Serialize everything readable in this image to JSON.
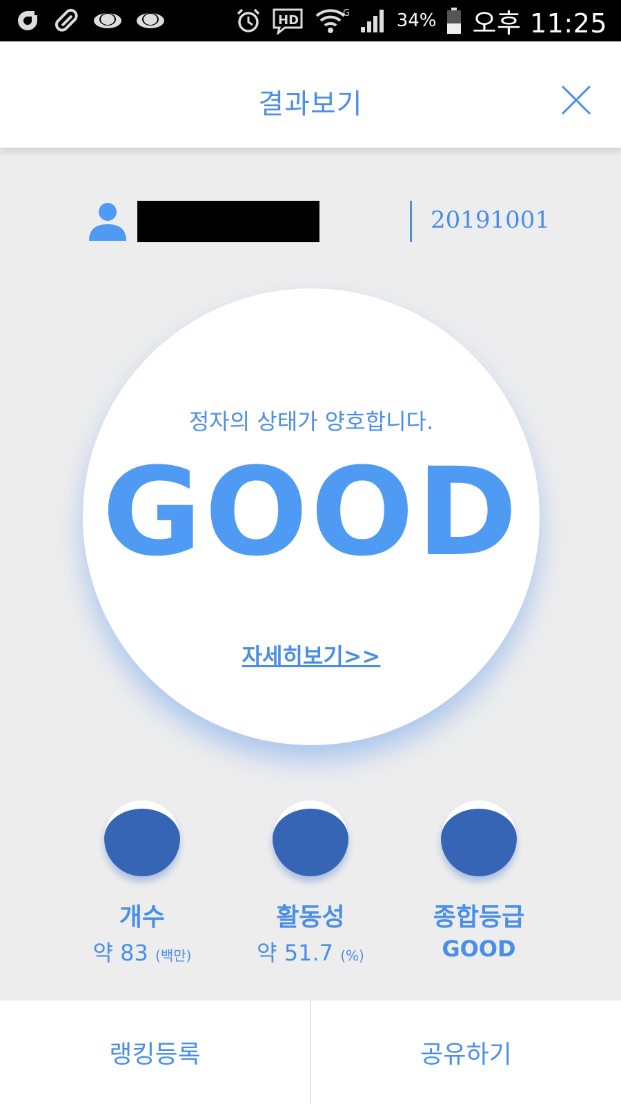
{
  "status_bar": {
    "battery": "34%",
    "time": "오후 11:25"
  },
  "header": {
    "title": "결과보기"
  },
  "user": {
    "date": "20191001"
  },
  "result": {
    "message": "정자의 상태가 양호합니다.",
    "grade": "GOOD",
    "detail_link": "자세히보기>>"
  },
  "stats": [
    {
      "label": "개수",
      "prefix": "약 ",
      "value": "83",
      "unit": "(백만)"
    },
    {
      "label": "활동성",
      "prefix": "약 ",
      "value": "51.7",
      "unit": "(%)"
    },
    {
      "label": "종합등급",
      "value": "GOOD"
    }
  ],
  "bottom": {
    "ranking": "랭킹등록",
    "share": "공유하기"
  },
  "colors": {
    "accent": "#4a8ee8",
    "grade": "#4f9af2",
    "dot": "#3565b4",
    "background": "#ededee"
  }
}
